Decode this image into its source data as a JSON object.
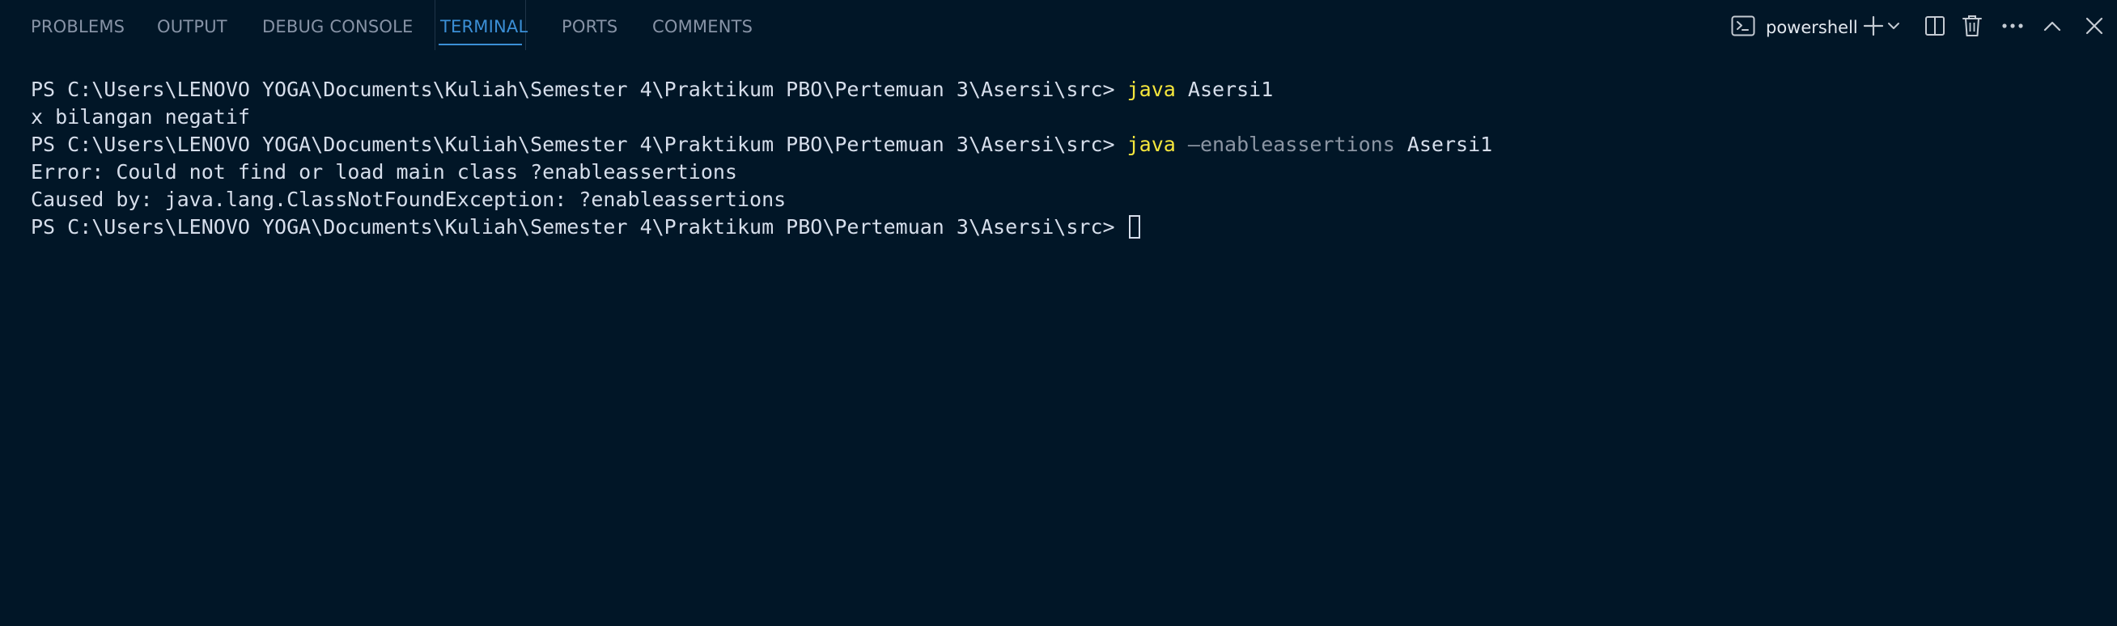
{
  "panel": {
    "tabs": [
      {
        "label": "PROBLEMS",
        "active": false
      },
      {
        "label": "OUTPUT",
        "active": false
      },
      {
        "label": "DEBUG CONSOLE",
        "active": false
      },
      {
        "label": "TERMINAL",
        "active": true
      },
      {
        "label": "PORTS",
        "active": false
      },
      {
        "label": "COMMENTS",
        "active": false
      }
    ],
    "actions": {
      "shell_name": "powershell",
      "icons": [
        "terminal-icon",
        "plus-icon",
        "chevron-down-icon",
        "split-icon",
        "trash-icon",
        "ellipsis-icon",
        "chevron-up-icon",
        "close-icon"
      ]
    }
  },
  "terminal": {
    "lines": [
      {
        "prompt": "PS C:\\Users\\LENOVO YOGA\\Documents\\Kuliah\\Semester 4\\Praktikum PBO\\Pertemuan 3\\Asersi\\src> ",
        "cmd": "java",
        "flag": "",
        "arg": " Asersi1"
      },
      {
        "text": "x bilangan negatif"
      },
      {
        "prompt": "PS C:\\Users\\LENOVO YOGA\\Documents\\Kuliah\\Semester 4\\Praktikum PBO\\Pertemuan 3\\Asersi\\src> ",
        "cmd": "java",
        "flag": " –enableassertions",
        "arg": " Asersi1"
      },
      {
        "text": "Error: Could not find or load main class ?enableassertions"
      },
      {
        "text": "Caused by: java.lang.ClassNotFoundException: ?enableassertions"
      },
      {
        "prompt": "PS C:\\Users\\LENOVO YOGA\\Documents\\Kuliah\\Semester 4\\Praktikum PBO\\Pertemuan 3\\Asersi\\src> ",
        "cursor": true
      }
    ]
  },
  "colors": {
    "background": "#011627",
    "tab_active": "#3b8fd6",
    "tab_inactive": "#8793a6",
    "command": "#f5e63c",
    "flag": "#8b95a3",
    "text": "#d6deeb"
  }
}
